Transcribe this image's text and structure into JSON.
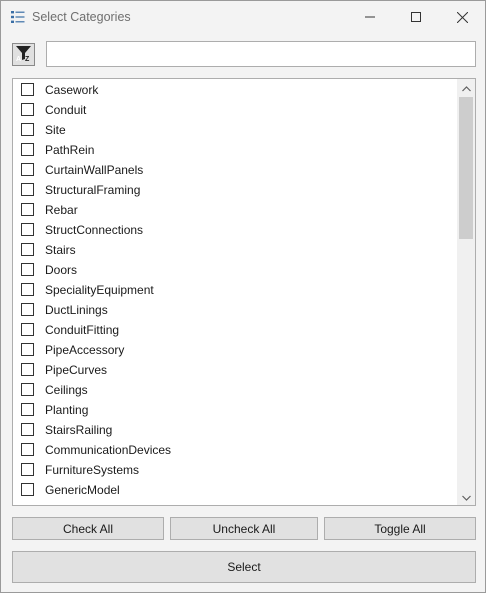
{
  "window": {
    "title": "Select Categories",
    "icons": {
      "app": "list-icon",
      "minimize": "minimize-icon",
      "maximize": "maximize-icon",
      "close": "close-icon"
    }
  },
  "toolbar": {
    "sort_icon": "sort-az-icon",
    "search_value": "",
    "search_placeholder": ""
  },
  "categories": {
    "items": [
      {
        "label": "Casework",
        "checked": false
      },
      {
        "label": "Conduit",
        "checked": false
      },
      {
        "label": "Site",
        "checked": false
      },
      {
        "label": "PathRein",
        "checked": false
      },
      {
        "label": "CurtainWallPanels",
        "checked": false
      },
      {
        "label": "StructuralFraming",
        "checked": false
      },
      {
        "label": "Rebar",
        "checked": false
      },
      {
        "label": "StructConnections",
        "checked": false
      },
      {
        "label": "Stairs",
        "checked": false
      },
      {
        "label": "Doors",
        "checked": false
      },
      {
        "label": "SpecialityEquipment",
        "checked": false
      },
      {
        "label": "DuctLinings",
        "checked": false
      },
      {
        "label": "ConduitFitting",
        "checked": false
      },
      {
        "label": "PipeAccessory",
        "checked": false
      },
      {
        "label": "PipeCurves",
        "checked": false
      },
      {
        "label": "Ceilings",
        "checked": false
      },
      {
        "label": "Planting",
        "checked": false
      },
      {
        "label": "StairsRailing",
        "checked": false
      },
      {
        "label": "CommunicationDevices",
        "checked": false
      },
      {
        "label": "FurnitureSystems",
        "checked": false
      },
      {
        "label": "GenericModel",
        "checked": false
      }
    ]
  },
  "actions": {
    "check_all": "Check All",
    "uncheck_all": "Uncheck All",
    "toggle_all": "Toggle All",
    "select": "Select"
  }
}
